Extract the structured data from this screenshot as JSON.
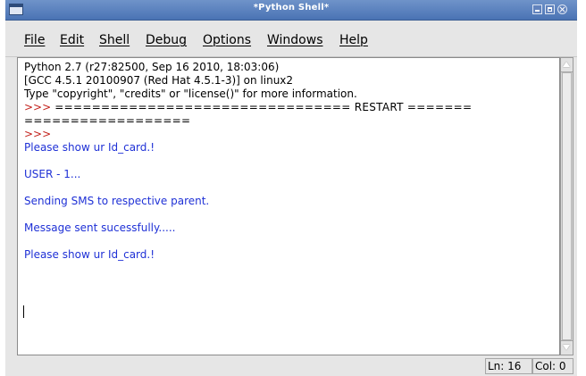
{
  "window": {
    "title": "*Python Shell*"
  },
  "menu": {
    "items": [
      "File",
      "Edit",
      "Shell",
      "Debug",
      "Options",
      "Windows",
      "Help"
    ]
  },
  "shell": {
    "banner_line1": "Python 2.7 (r27:82500, Sep 16 2010, 18:03:06)",
    "banner_line2": "[GCC 4.5.1 20100907 (Red Hat 4.5.1-3)] on linux2",
    "banner_line3": "Type \"copyright\", \"credits\" or \"license()\" for more information.",
    "restart_line1_prompt": ">>>",
    "restart_line1_rule": " ================================ RESTART =======",
    "restart_line2_rule": "==================",
    "prompt": ">>>",
    "output": [
      "Please show ur Id_card.!",
      "USER - 1...",
      "Sending SMS to respective parent.",
      "Message sent sucessfully.....",
      "Please show ur Id_card.!"
    ]
  },
  "status": {
    "line": "Ln: 16",
    "col": "Col: 0"
  },
  "colors": {
    "prompt": "#c3221c",
    "output": "#1f31d6",
    "titlebar": "#4a73b4"
  }
}
